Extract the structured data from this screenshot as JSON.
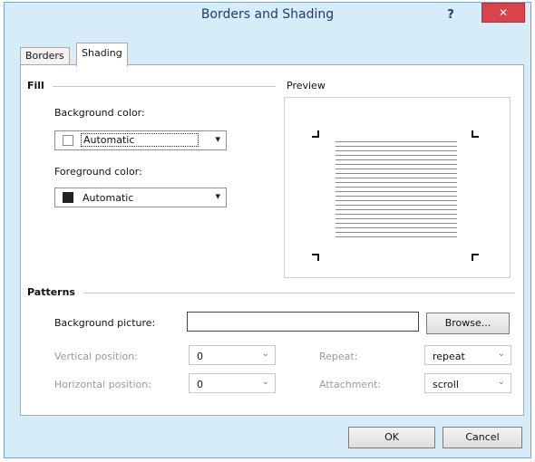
{
  "window": {
    "title": "Borders and Shading",
    "help": "?",
    "close": "✕"
  },
  "tabs": [
    {
      "label": "Borders"
    },
    {
      "label": "Shading"
    }
  ],
  "fill": {
    "group_label": "Fill",
    "background_label": "Background color:",
    "background_value": "Automatic",
    "foreground_label": "Foreground color:",
    "foreground_value": "Automatic"
  },
  "preview": {
    "group_label": "Preview"
  },
  "patterns": {
    "group_label": "Patterns",
    "picture_label": "Background picture:",
    "picture_value": "",
    "browse_label": "Browse...",
    "vertical_label": "Vertical position:",
    "vertical_value": "0",
    "horizontal_label": "Horizontal position:",
    "horizontal_value": "0",
    "repeat_label": "Repeat:",
    "repeat_value": "repeat",
    "attachment_label": "Attachment:",
    "attachment_value": "scroll"
  },
  "footer": {
    "ok_label": "OK",
    "cancel_label": "Cancel"
  },
  "colors": {
    "title_bg": "#d7ecf9",
    "close_red": "#d9434a",
    "swatch_dark": "#222222"
  }
}
